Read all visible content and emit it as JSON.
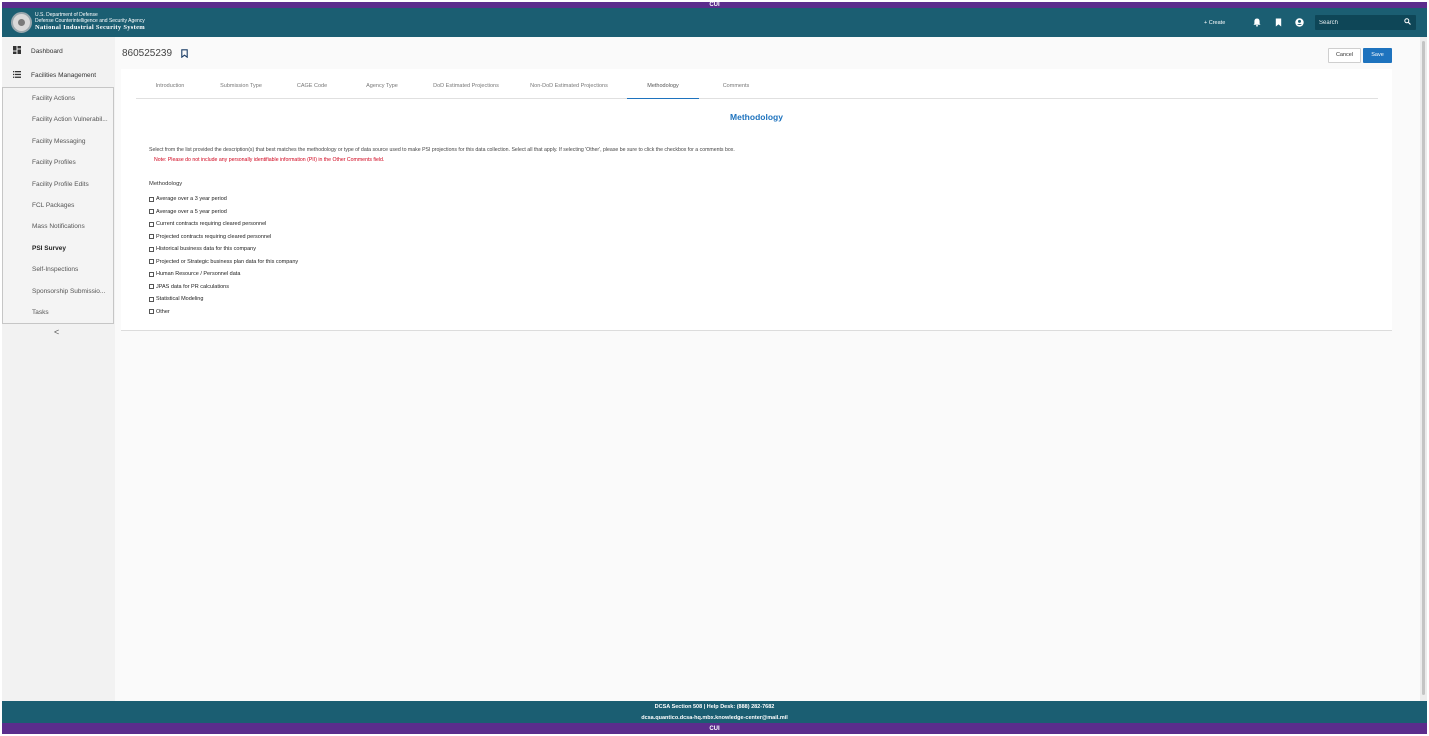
{
  "banner": {
    "classification": "CUI"
  },
  "header": {
    "agency_line1": "U.S. Department of Defense",
    "agency_line2": "Defense Counterintelligence and Security Agency",
    "system_name": "National Industrial Security System",
    "create_label": "+ Create",
    "search_placeholder": "Search",
    "icons": [
      "bell-icon",
      "bookmark-icon",
      "account-icon",
      "search-icon"
    ]
  },
  "sidebar": {
    "dashboard_label": "Dashboard",
    "facilities_label": "Facilities Management",
    "items": [
      {
        "label": "Facility Actions"
      },
      {
        "label": "Facility Action Vulnerabil..."
      },
      {
        "label": "Facility Messaging"
      },
      {
        "label": "Facility Profiles"
      },
      {
        "label": "Facility Profile Edits"
      },
      {
        "label": "FCL Packages"
      },
      {
        "label": "Mass Notifications"
      },
      {
        "label": "PSI Survey",
        "active": true
      },
      {
        "label": "Self-Inspections"
      },
      {
        "label": "Sponsorship Submissio..."
      },
      {
        "label": "Tasks"
      }
    ],
    "collapse_glyph": "<"
  },
  "main": {
    "record_id": "860525239",
    "cancel_label": "Cancel",
    "save_label": "Save",
    "tabs": [
      {
        "label": "Introduction"
      },
      {
        "label": "Submission Type"
      },
      {
        "label": "CAGE Code"
      },
      {
        "label": "Agency Type"
      },
      {
        "label": "DoD Estimated Projections"
      },
      {
        "label": "Non-DoD Estimated Projections"
      },
      {
        "label": "Methodology",
        "active": true
      },
      {
        "label": "Comments"
      }
    ],
    "section_title": "Methodology",
    "instructions": "Select from the list provided the description(s) that best matches the methodology or type of data source used to make PSI projections for this data collection. Select all that apply. If selecting 'Other', please be sure to click the checkbox for a comments box.",
    "note": "Note: Please do not include any personally identifiable information (PII) in the Other Comments field.",
    "methodology_label": "Methodology",
    "options": [
      {
        "label": "Average over a 3 year period",
        "checked": false
      },
      {
        "label": "Average over a 5 year period",
        "checked": false
      },
      {
        "label": "Current contracts requiring cleared personnel",
        "checked": false
      },
      {
        "label": "Projected contracts requiring cleared personnel",
        "checked": false
      },
      {
        "label": "Historical business data for this company",
        "checked": false
      },
      {
        "label": "Projected or Strategic business plan data for this company",
        "checked": false
      },
      {
        "label": "Human Resource / Personnel data",
        "checked": false
      },
      {
        "label": "JPAS data for PR calculations",
        "checked": false
      },
      {
        "label": "Statistical Modeling",
        "checked": false
      },
      {
        "label": "Other",
        "checked": false
      }
    ]
  },
  "footer": {
    "line1": "DCSA Section 508 | Help Desk: (888) 282-7682",
    "line2": "dcsa.quantico.dcsa-hq.mbx.knowledge-center@mail.mil"
  },
  "colors": {
    "banner_purple": "#5b2d8c",
    "header_teal": "#1b5e72",
    "accent_blue": "#1e73be",
    "note_red": "#d0021b"
  }
}
